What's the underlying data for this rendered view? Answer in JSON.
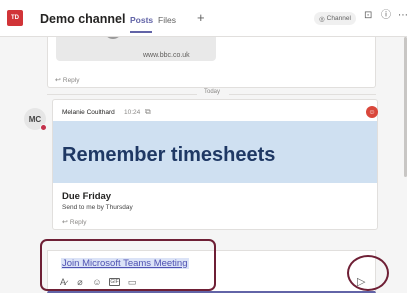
{
  "header": {
    "team_initials": "TD",
    "channel_title": "Demo channel",
    "tabs": [
      {
        "label": "Posts",
        "active": true
      },
      {
        "label": "Files",
        "active": false
      }
    ],
    "add_tab": "+",
    "channel_pill": "Channel",
    "icons": [
      "video-call-icon",
      "info-icon",
      "more-icon"
    ]
  },
  "feed": {
    "previous_post": {
      "link_url": "www.bbc.co.uk",
      "reply_label": "Reply"
    },
    "day_separator": "Today",
    "post": {
      "avatar_initials": "MC",
      "author": "Melanie Coulthard",
      "time": "10:24",
      "banner_title": "Remember timesheets",
      "heading": "Due Friday",
      "body": "Send to me by Thursday",
      "reply_label": "Reply"
    }
  },
  "compose": {
    "content": "Join Microsoft Teams Meeting",
    "toolbar_icons": [
      "format-icon",
      "attach-icon",
      "emoji-icon",
      "gif-icon",
      "sticker-icon"
    ],
    "gif_label": "GIF",
    "send_icon": "send-icon"
  },
  "colors": {
    "accent": "#6264a7",
    "team_badge": "#d13438",
    "banner_background": "#cfe0f1",
    "banner_text": "#1f3864",
    "annotation": "#6e1f35"
  }
}
